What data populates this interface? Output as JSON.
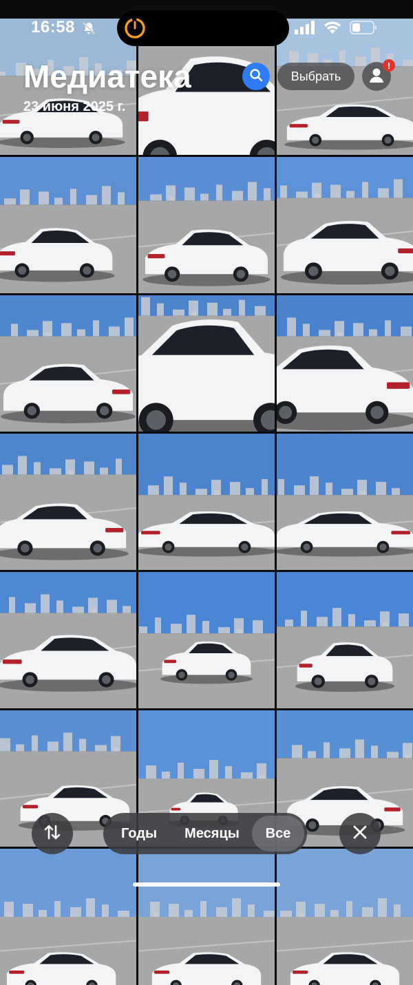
{
  "status_bar": {
    "time": "16:58"
  },
  "header": {
    "title": "Медиатека",
    "date": "23 июня 2025 г."
  },
  "actions": {
    "select_label": "Выбрать",
    "avatar_badge": "!"
  },
  "tabs": {
    "years": "Годы",
    "months": "Месяцы",
    "all": "Все",
    "active": "all"
  },
  "photos": [
    {
      "scene": "rear-closeup-top"
    },
    {
      "scene": "taillight-closeup"
    },
    {
      "scene": "side-rear"
    },
    {
      "scene": "rear-three-quarter-billboard"
    },
    {
      "scene": "rear-three-quarter-city"
    },
    {
      "scene": "front-three-quarter"
    },
    {
      "scene": "front-three-quarter-left"
    },
    {
      "scene": "grille-closeup"
    },
    {
      "scene": "front-headlight"
    },
    {
      "scene": "front-left-grass"
    },
    {
      "scene": "side-profile"
    },
    {
      "scene": "side-profile-right"
    },
    {
      "scene": "rear-three-quarter-left"
    },
    {
      "scene": "rear-three-quarter-sky"
    },
    {
      "scene": "rear-view"
    },
    {
      "scene": "rear-billboard"
    },
    {
      "scene": "front-distance"
    },
    {
      "scene": "front-right"
    },
    {
      "scene": "partial-a"
    },
    {
      "scene": "partial-b"
    },
    {
      "scene": "partial-c"
    }
  ]
}
